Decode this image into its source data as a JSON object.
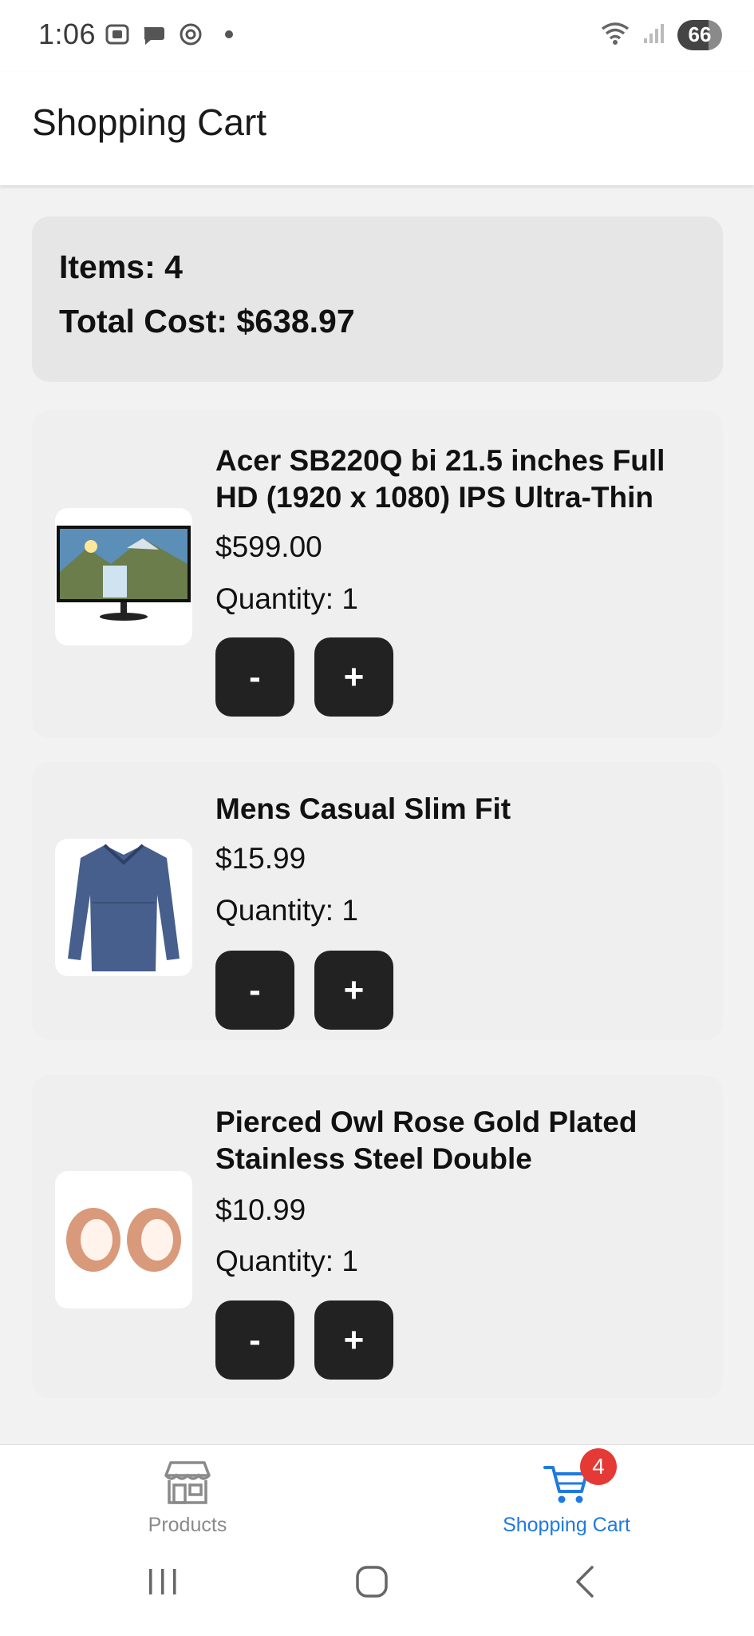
{
  "status_bar": {
    "time": "1:06",
    "battery": "66"
  },
  "header": {
    "title": "Shopping Cart"
  },
  "summary": {
    "items_text": "Items: 4",
    "total_text": "Total Cost: $638.97"
  },
  "cart_items": [
    {
      "name": "Acer SB220Q bi 21.5 inches Full HD (1920 x 1080) IPS Ultra-Thin",
      "price": "$599.00",
      "quantity_text": "Quantity: 1",
      "thumbnail_icon": "monitor-image"
    },
    {
      "name": "Mens Casual Slim Fit",
      "price": "$15.99",
      "quantity_text": "Quantity: 1",
      "thumbnail_icon": "shirt-image"
    },
    {
      "name": "Pierced Owl Rose Gold Plated Stainless Steel Double",
      "price": "$10.99",
      "quantity_text": "Quantity: 1",
      "thumbnail_icon": "earrings-image"
    }
  ],
  "buttons": {
    "decrease_label": "-",
    "increase_label": "+"
  },
  "bottom_nav": {
    "products_label": "Products",
    "cart_label": "Shopping Cart",
    "cart_badge": "4",
    "active_color": "#1f7ae0",
    "inactive_color": "#8a8a8a",
    "badge_color": "#e53935"
  }
}
